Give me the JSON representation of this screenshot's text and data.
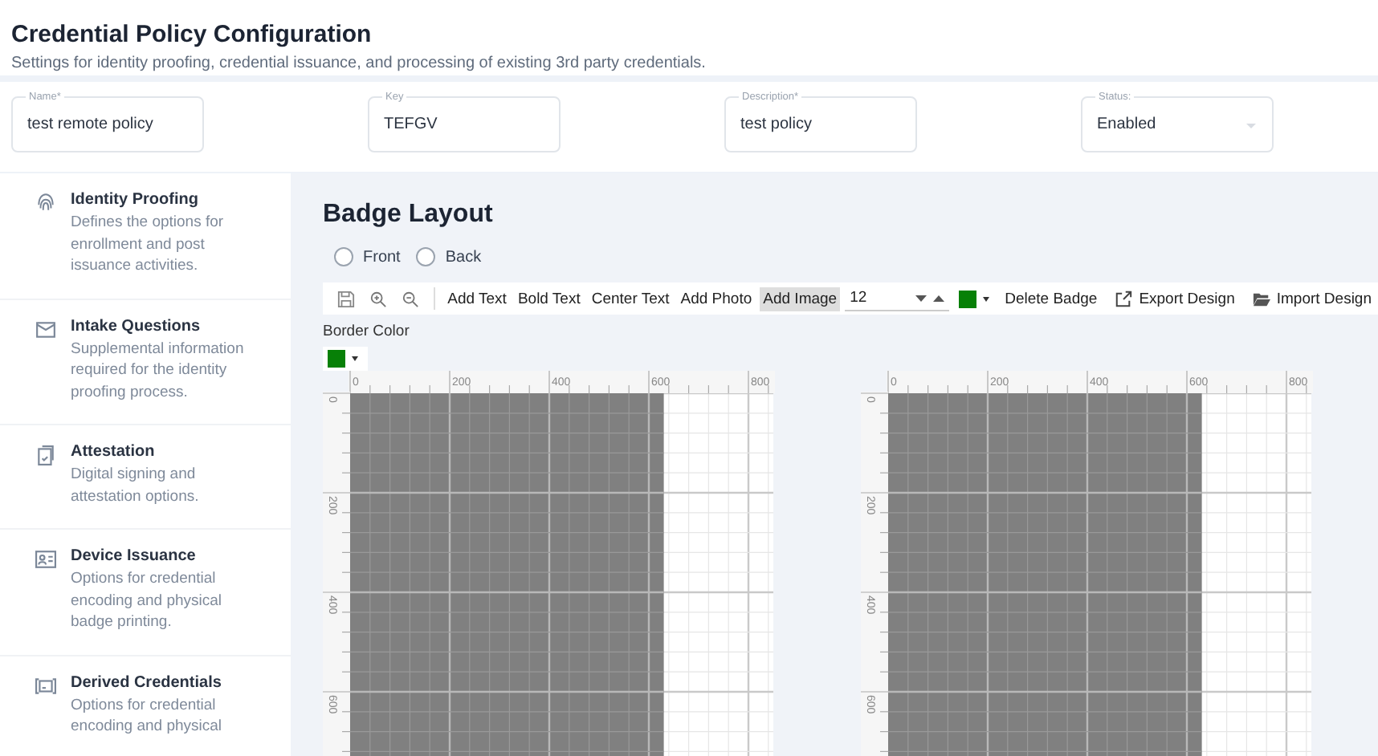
{
  "header": {
    "title": "Credential Policy Configuration",
    "subtitle": "Settings for identity proofing, credential issuance, and processing of existing 3rd party credentials."
  },
  "fields": [
    {
      "kind": "text",
      "label": "Name*",
      "value": "test remote policy"
    },
    {
      "kind": "text",
      "label": "Key",
      "value": "TEFGV"
    },
    {
      "kind": "text",
      "label": "Description*",
      "value": "test policy"
    },
    {
      "kind": "select",
      "label": "Status:",
      "value": "Enabled"
    }
  ],
  "sidebar": {
    "items": [
      {
        "title": "Identity Proofing",
        "description": "Defines the options for enrollment and post issuance activities."
      },
      {
        "title": "Intake Questions",
        "description": "Supplemental information required for the identity proofing process."
      },
      {
        "title": "Attestation",
        "description": "Digital signing and attestation options."
      },
      {
        "title": "Device Issuance",
        "description": "Options for credential encoding and physical badge printing."
      },
      {
        "title": "Derived Credentials",
        "description": "Options for credential encoding and physical"
      }
    ]
  },
  "badge_layout": {
    "title": "Badge Layout",
    "sides": [
      {
        "label": "Front",
        "selected": false
      },
      {
        "label": "Back",
        "selected": false
      }
    ],
    "toolbar": {
      "tools": [
        {
          "label": "Add Text",
          "selected": false
        },
        {
          "label": "Bold Text",
          "selected": false
        },
        {
          "label": "Center Text",
          "selected": false
        },
        {
          "label": "Add Photo",
          "selected": false
        },
        {
          "label": "Add Image",
          "selected": true
        }
      ],
      "font_size": "12",
      "text_color": {
        "color": "#078007"
      },
      "actions": [
        {
          "kind": "delete",
          "label": "Delete Badge"
        },
        {
          "kind": "export",
          "label": "Export Design"
        },
        {
          "kind": "import",
          "label": "Import Design"
        }
      ]
    },
    "border_color_label": "Border Color",
    "border_color": {
      "color": "#078007"
    },
    "canvases": [
      {
        "x_ruler": [
          "0",
          "200",
          "400",
          "600",
          "800"
        ],
        "y_ruler": [
          "0",
          "200",
          "400",
          "600"
        ]
      },
      {
        "x_ruler": [
          "0",
          "200",
          "400",
          "600",
          "800"
        ],
        "y_ruler": [
          "0",
          "200",
          "400",
          "600"
        ]
      }
    ]
  }
}
